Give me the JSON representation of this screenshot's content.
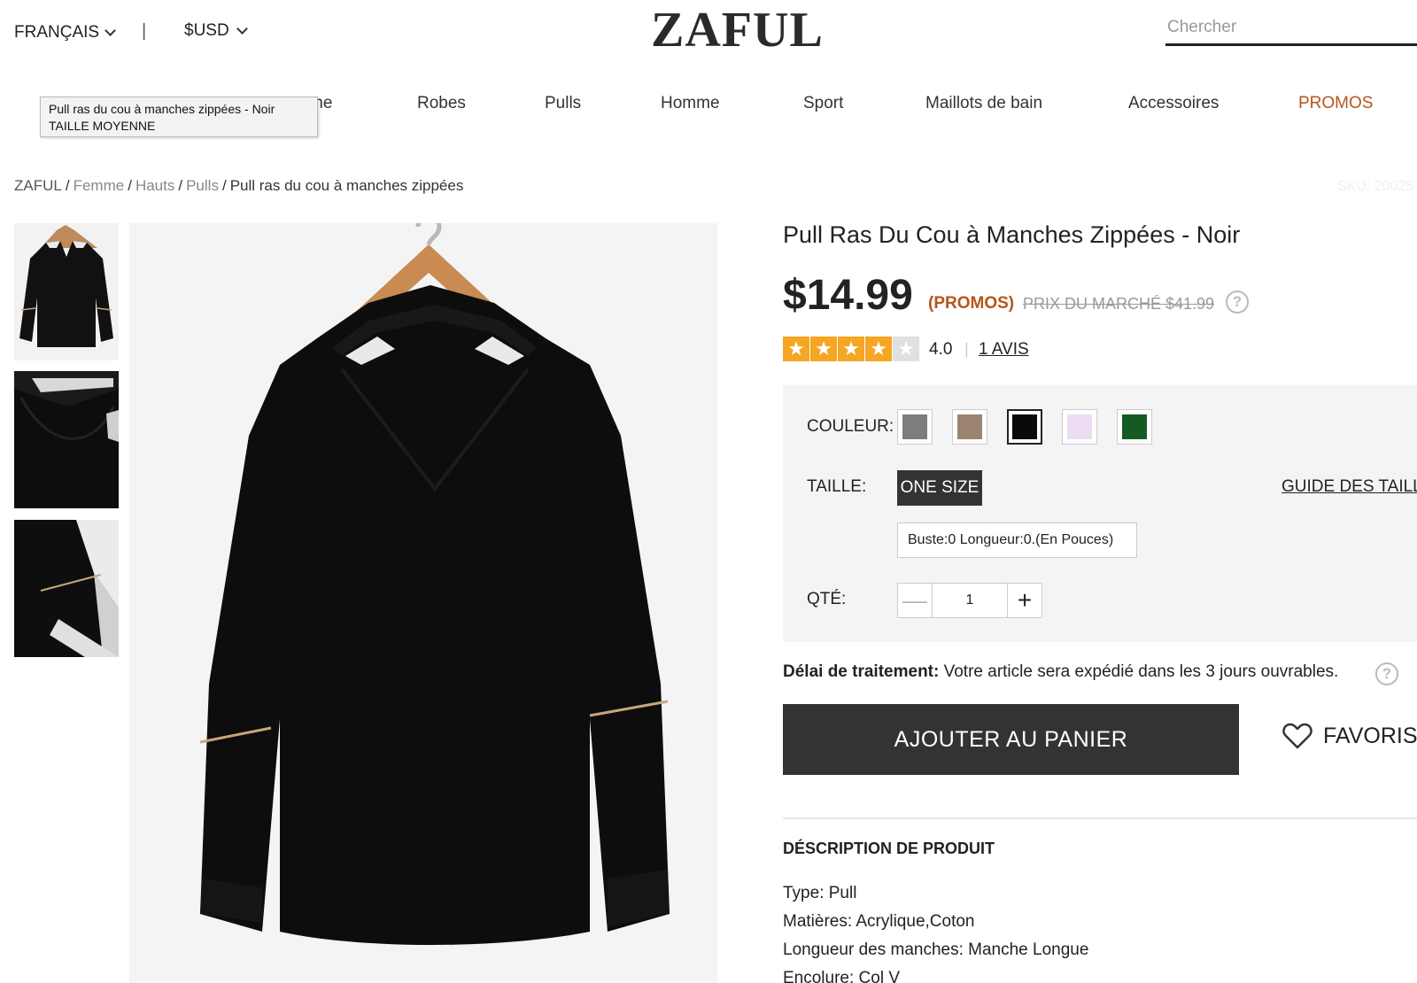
{
  "topbar": {
    "language": "FRANÇAIS",
    "separator": "|",
    "currency": "$USD",
    "logo": "ZAFUL",
    "search_placeholder": "Chercher"
  },
  "nav": {
    "items": [
      {
        "label": "me"
      },
      {
        "label": "Robes"
      },
      {
        "label": "Pulls"
      },
      {
        "label": "Homme"
      },
      {
        "label": "Sport"
      },
      {
        "label": "Maillots de bain"
      },
      {
        "label": "Accessoires"
      },
      {
        "label": "PROMOS",
        "highlight": true
      }
    ]
  },
  "tooltip": {
    "line1": "Pull ras du cou à manches zippées - Noir",
    "line2": "TAILLE MOYENNE"
  },
  "breadcrumb": {
    "items": [
      "ZAFUL",
      "Femme",
      "Hauts",
      "Pulls"
    ],
    "separator": "/",
    "current": "Pull ras du cou à manches zippées"
  },
  "sku": "SKU: 20025",
  "product": {
    "title": "Pull Ras Du Cou à Manches Zippées - Noir",
    "price": "$14.99",
    "promo_tag": "(PROMOS)",
    "market_price": "PRIX DU MARCHÉ $41.99",
    "help_icon": "?",
    "rating": 4.0,
    "rating_text": "4.0",
    "rating_separator": "|",
    "star_glyph": "★",
    "reviews": "1 AVIS"
  },
  "options": {
    "color_label": "COULEUR:",
    "colors": [
      {
        "name": "gray",
        "hex": "#7d7d7d"
      },
      {
        "name": "khaki",
        "hex": "#9a8470"
      },
      {
        "name": "black",
        "hex": "#0a0a0a",
        "selected": true
      },
      {
        "name": "light-purple",
        "hex": "#ecdcf2"
      },
      {
        "name": "green",
        "hex": "#145a22"
      }
    ],
    "size_label": "TAILLE:",
    "size_value": "ONE SIZE",
    "size_guide": "GUIDE DES TAILLES",
    "measurements": "Buste:0   Longueur:0.(En Pouces)",
    "qty_label": "QTÉ:",
    "qty_value": "1",
    "qty_minus": "—",
    "qty_plus": "+"
  },
  "shipping": {
    "label": "Délai de traitement:",
    "text": " Votre article sera expédié dans les 3 jours ouvrables."
  },
  "actions": {
    "add_to_cart": "AJOUTER AU PANIER",
    "favorites": "FAVORIS"
  },
  "description": {
    "title": "DÉSCRIPTION DE PRODUIT",
    "lines": [
      "Type: Pull",
      "Matières: Acrylique,Coton",
      "Longueur des manches: Manche Longue",
      "Encolure: Col V"
    ]
  },
  "colors": {
    "promo": "#b5561b",
    "star": "#f5a623",
    "button_dark": "#333333"
  }
}
